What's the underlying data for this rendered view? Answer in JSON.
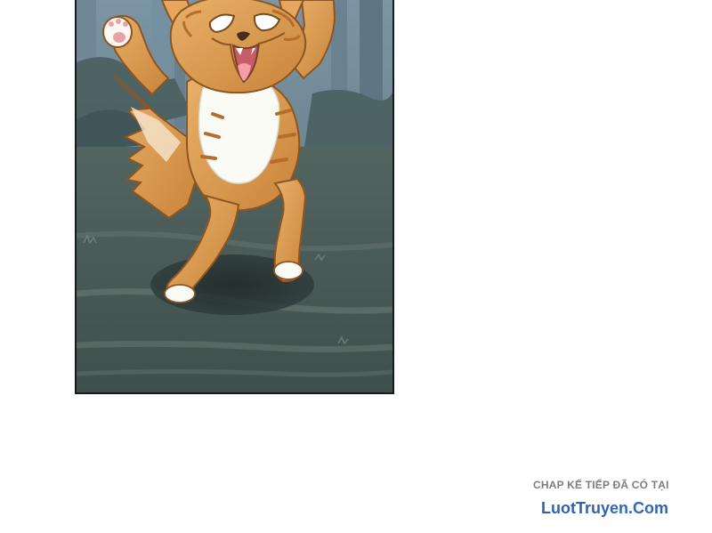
{
  "panel": {
    "scene": "comic-panel-cat",
    "colors": {
      "sky": "#7f98a8",
      "foliage": "#536768",
      "ground": "#4f5f5a",
      "path": "#66736d",
      "shadow": "#243232",
      "fur": "#d99a50",
      "fur_dark": "#b56d2b",
      "fur_light": "#f4dfbf",
      "white": "#fbfbf6",
      "mouth": "#d36c75",
      "tongue": "#f2a0a6",
      "paw_pad": "#e7a2aa"
    }
  },
  "footer": {
    "note": "CHAP KẾ TIẾP ĐÃ CÓ TẠI",
    "brand": "LuotTruyen.Com",
    "note_color": "#7e7e7e",
    "brand_color": "#2f63ad"
  }
}
